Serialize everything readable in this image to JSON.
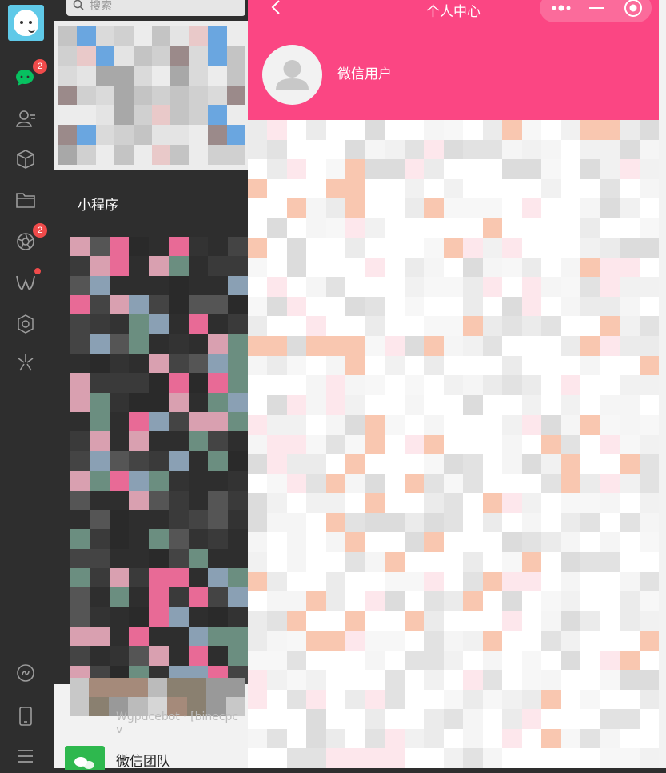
{
  "sidebar": {
    "badges": {
      "chats": "2",
      "moments": "2"
    }
  },
  "search": {
    "placeholder": "搜索"
  },
  "mini_programs": {
    "title": "小程序"
  },
  "contacts": {
    "blurred_line": "Wgpdcebot · [binecpc v",
    "wechat_team": "微信团队"
  },
  "panel": {
    "title": "个人中心",
    "user_name": "微信用户"
  },
  "colors": {
    "accent": "#fb4683",
    "wechat_green": "#2eb84e",
    "badge": "#f04b4b"
  }
}
